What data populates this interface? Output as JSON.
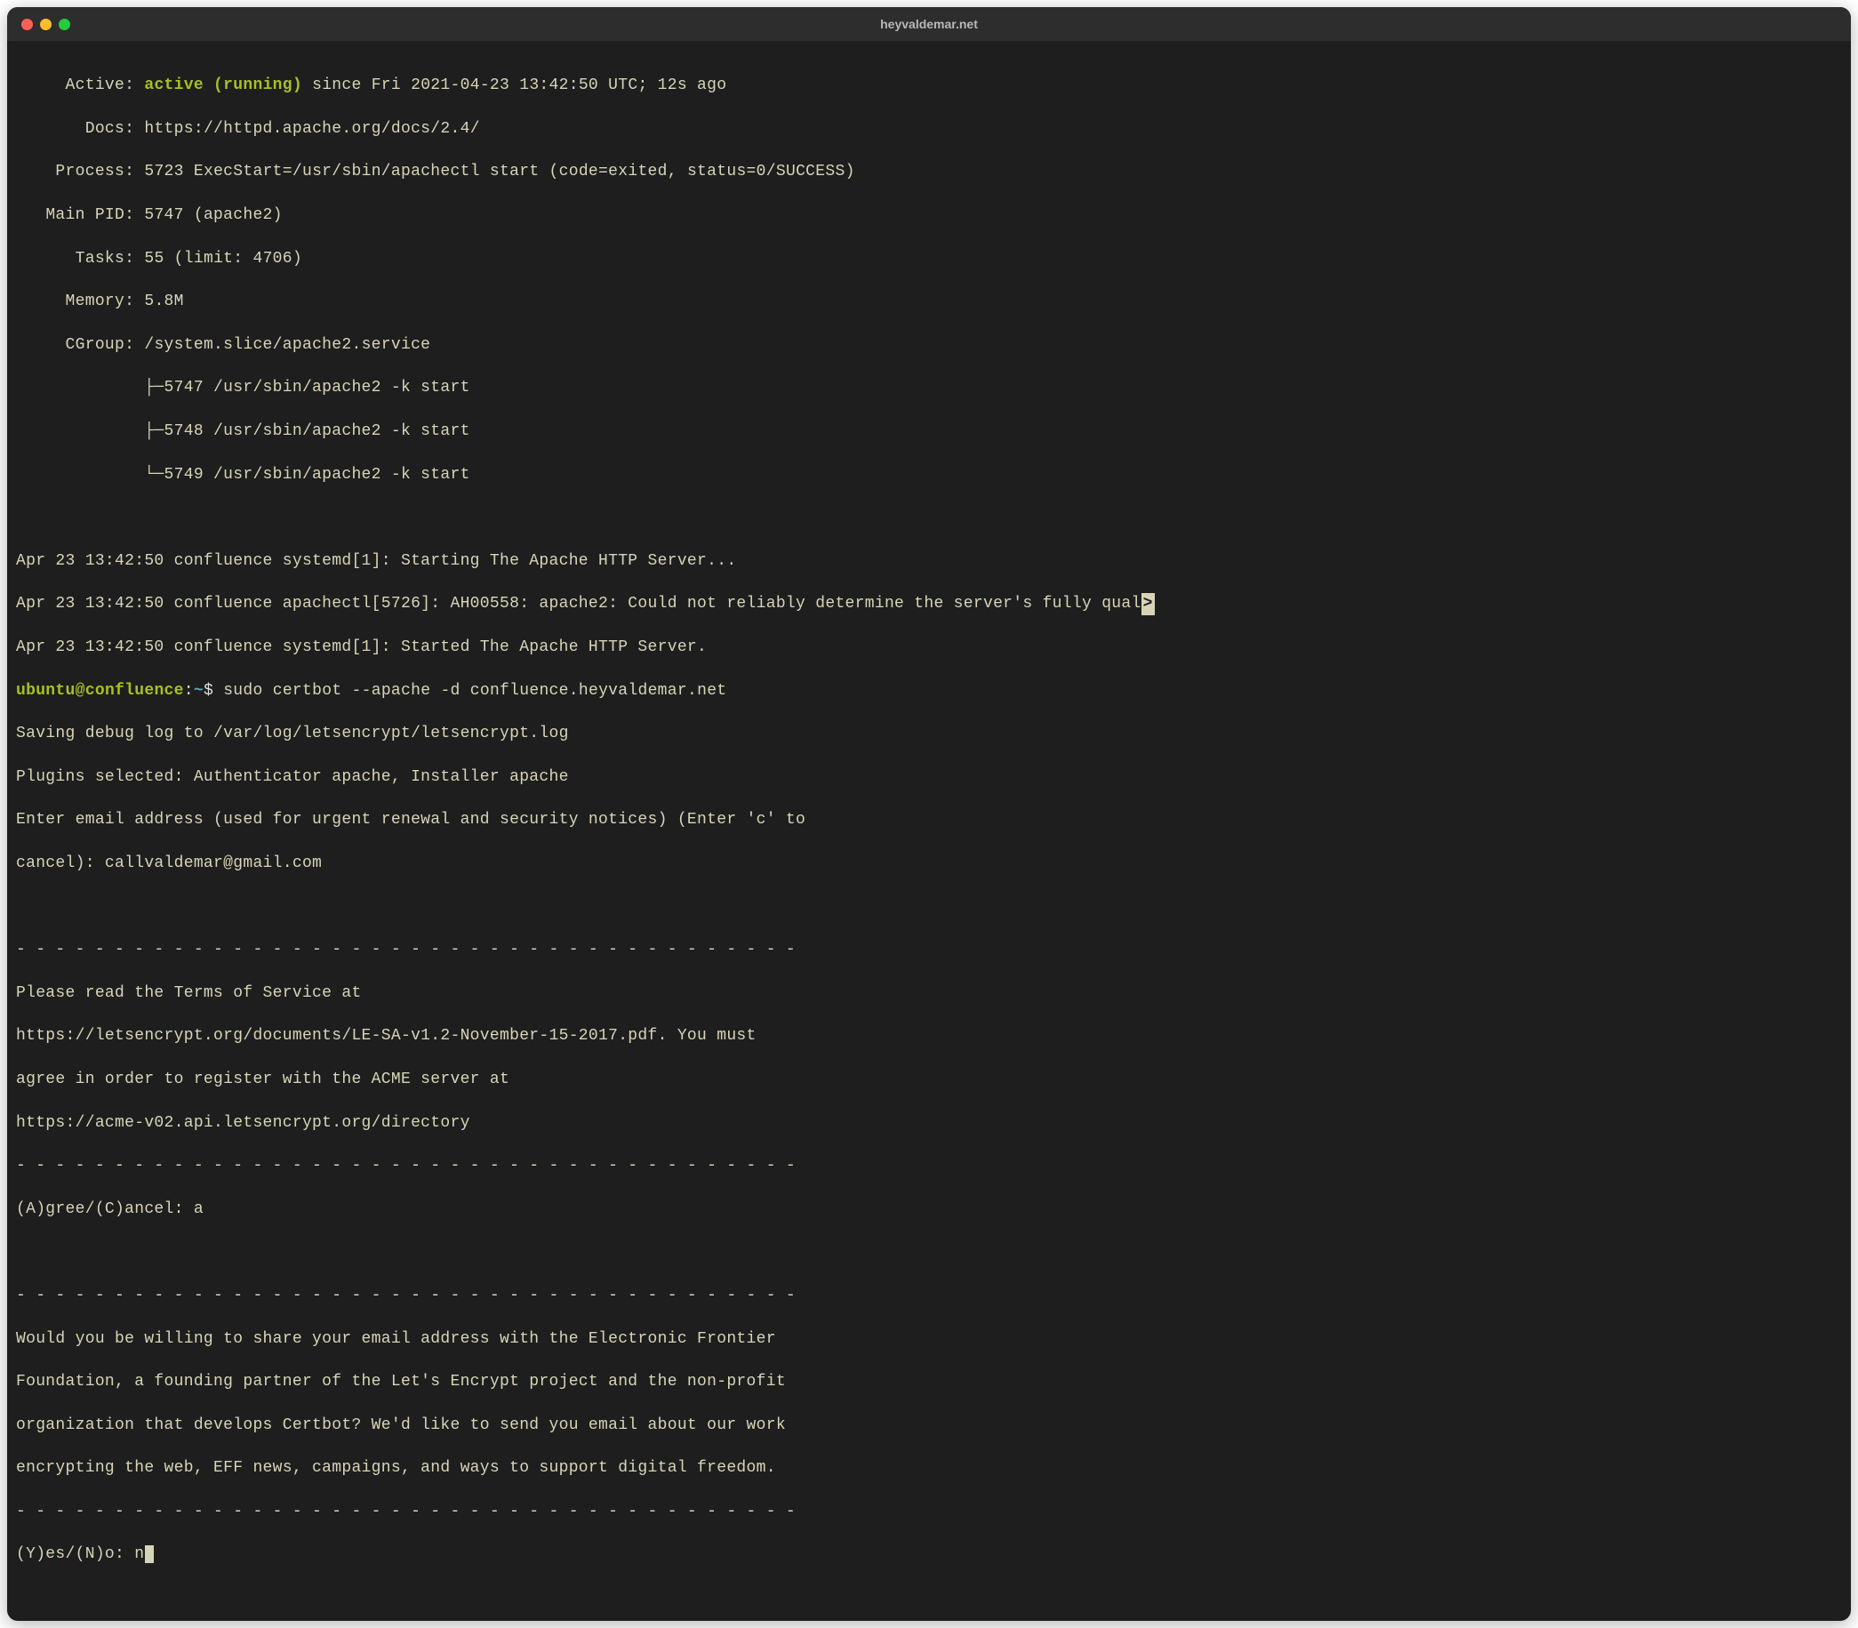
{
  "window": {
    "title": "heyvaldemar.net"
  },
  "status": {
    "active_label": "Active:",
    "active_value": "active (running)",
    "active_since": " since Fri 2021-04-23 13:42:50 UTC; 12s ago",
    "docs_label": "Docs:",
    "docs_value": " https://httpd.apache.org/docs/2.4/",
    "process_label": "Process:",
    "process_value": " 5723 ExecStart=/usr/sbin/apachectl start (code=exited, status=0/SUCCESS)",
    "mainpid_label": "Main PID:",
    "mainpid_value": " 5747 (apache2)",
    "tasks_label": "Tasks:",
    "tasks_value": " 55 (limit: 4706)",
    "memory_label": "Memory:",
    "memory_value": " 5.8M",
    "cgroup_label": "CGroup:",
    "cgroup_value": " /system.slice/apache2.service",
    "tree1": "             ├─5747 /usr/sbin/apache2 -k start",
    "tree2": "             ├─5748 /usr/sbin/apache2 -k start",
    "tree3": "             └─5749 /usr/sbin/apache2 -k start"
  },
  "log": {
    "l1": "Apr 23 13:42:50 confluence systemd[1]: Starting The Apache HTTP Server...",
    "l2a": "Apr 23 13:42:50 confluence apachectl[5726]: AH00558: apache2: Could not reliably determine the server's fully qual",
    "l2b": ">",
    "l3": "Apr 23 13:42:50 confluence systemd[1]: Started The Apache HTTP Server."
  },
  "prompt": {
    "user": "ubuntu",
    "at": "@",
    "host": "confluence",
    "sep": ":",
    "path": "~",
    "dollar": "$ ",
    "command": "sudo certbot --apache -d confluence.heyvaldemar.net"
  },
  "out": {
    "l1": "Saving debug log to /var/log/letsencrypt/letsencrypt.log",
    "l2": "Plugins selected: Authenticator apache, Installer apache",
    "l3": "Enter email address (used for urgent renewal and security notices) (Enter 'c' to",
    "l4": "cancel): callvaldemar@gmail.com",
    "blank": " ",
    "dash": "- - - - - - - - - - - - - - - - - - - - - - - - - - - - - - - - - - - - - - - -",
    "t1": "Please read the Terms of Service at",
    "t2": "https://letsencrypt.org/documents/LE-SA-v1.2-November-15-2017.pdf. You must",
    "t3": "agree in order to register with the ACME server at",
    "t4": "https://acme-v02.api.letsencrypt.org/directory",
    "agree": "(A)gree/(C)ancel: a",
    "e1": "Would you be willing to share your email address with the Electronic Frontier",
    "e2": "Foundation, a founding partner of the Let's Encrypt project and the non-profit",
    "e3": "organization that develops Certbot? We'd like to send you email about our work",
    "e4": "encrypting the web, EFF news, campaigns, and ways to support digital freedom.",
    "yn": "(Y)es/(N)o: n"
  }
}
